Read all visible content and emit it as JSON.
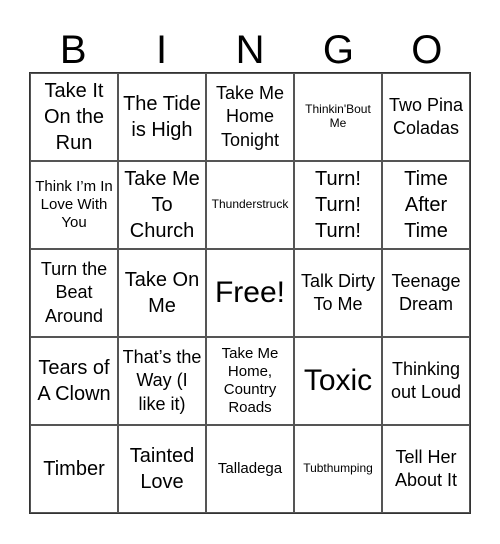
{
  "header": {
    "letters": [
      "B",
      "I",
      "N",
      "G",
      "O"
    ]
  },
  "cells": [
    [
      "Take It On the Run",
      "The Tide is High",
      "Take Me Home Tonight",
      "Thinkin'Bout Me",
      "Two Pina Coladas"
    ],
    [
      "Think I’m In Love With You",
      "Take Me To Church",
      "Thunderstruck",
      "Turn! Turn! Turn!",
      "Time After Time"
    ],
    [
      "Turn the Beat Around",
      "Take On Me",
      "Free!",
      "Talk Dirty To Me",
      "Teenage Dream"
    ],
    [
      "Tears of A Clown",
      "That’s the Way (I like it)",
      "Take Me Home, Country Roads",
      "Toxic",
      "Thinking out Loud"
    ],
    [
      "Timber",
      "Tainted Love",
      "Talladega",
      "Tubthumping",
      "Tell Her About It"
    ]
  ]
}
